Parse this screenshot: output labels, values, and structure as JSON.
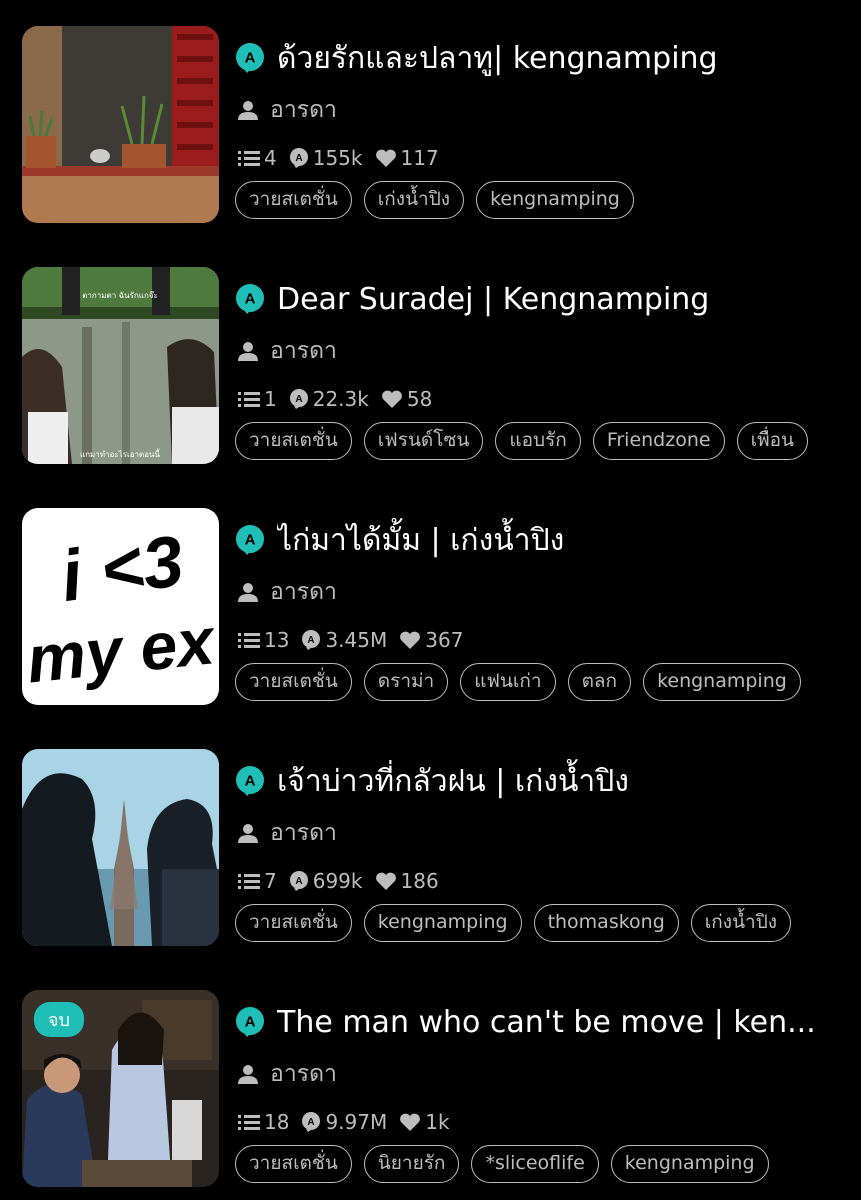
{
  "colors": {
    "accent": "#1fbfb8",
    "text": "#ffffff",
    "muted": "#bdbdbd",
    "background": "#000000"
  },
  "icons": {
    "chapters": "list-icon",
    "views": "reads-icon",
    "likes": "heart-icon",
    "author": "person-icon",
    "title_badge": "a-badge-icon"
  },
  "stories": [
    {
      "title": "ด้วยรักและปลาทู| kengnamping",
      "author": "อารดา",
      "chapters": "4",
      "views": "155k",
      "likes": "117",
      "tags": [
        "วายสเตชั่น",
        "เก่งน้ำปิง",
        "kengnamping"
      ],
      "badge": ""
    },
    {
      "title": "Dear Suradej | Kengnamping",
      "author": "อารดา",
      "chapters": "1",
      "views": "22.3k",
      "likes": "58",
      "tags": [
        "วายสเตชั่น",
        "เฟรนด์โซน",
        "แอบรัก",
        "Friendzone",
        "เพื่อน"
      ],
      "badge": "",
      "image_text": [
        "ตากามตา ฉันรักแกจ๊ะ",
        "แกมาทำอะไรเอาตอนนี้"
      ]
    },
    {
      "title": "ไก่มาได้มั้ม | เก่งน้ำปิง",
      "author": "อารดา",
      "chapters": "13",
      "views": "3.45M",
      "likes": "367",
      "tags": [
        "วายสเตชั่น",
        "ดราม่า",
        "แฟนเก่า",
        "ตลก",
        "kengnamping"
      ],
      "badge": "",
      "image_text": [
        "i <3",
        "my ex"
      ]
    },
    {
      "title": "เจ้าบ่าวที่กลัวฝน | เก่งน้ำปิง",
      "author": "อารดา",
      "chapters": "7",
      "views": "699k",
      "likes": "186",
      "tags": [
        "วายสเตชั่น",
        "kengnamping",
        "thomaskong",
        "เก่งน้ำปิง"
      ],
      "badge": ""
    },
    {
      "title": "The man who can't be move | ken...",
      "author": "อารดา",
      "chapters": "18",
      "views": "9.97M",
      "likes": "1k",
      "tags": [
        "วายสเตชั่น",
        "นิยายรัก",
        "*sliceoflife",
        "kengnamping"
      ],
      "badge": "จบ"
    }
  ]
}
